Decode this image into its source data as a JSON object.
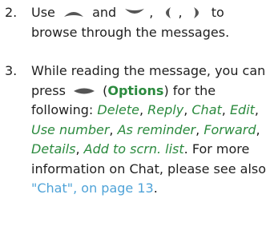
{
  "step1": {
    "number": "2.",
    "text_use": "Use",
    "text_and": "and",
    "text_comma1": ",",
    "text_comma2": ",",
    "text_to": "to",
    "text_rest": "browse through the messages."
  },
  "step2": {
    "number": "3.",
    "text_intro": "While reading the message, you can press",
    "paren_open": "(",
    "options_label": "Options",
    "paren_close": ")",
    "text_following": "for the following:",
    "options": [
      "Delete",
      "Reply",
      "Chat",
      "Edit",
      "Use number",
      "As reminder",
      "Forward",
      "Details",
      "Add to scrn. list"
    ],
    "text_more": "For more information on Chat, please see also",
    "link_text": "\"Chat\", on page 13",
    "end_period": "."
  },
  "icons": {
    "scroll_up": "scroll-up-key-icon",
    "scroll_down": "scroll-down-key-icon",
    "scroll_left": "scroll-left-key-icon",
    "scroll_right": "scroll-right-key-icon",
    "selection_key": "selection-key-icon"
  },
  "colors": {
    "text": "#1f1f1f",
    "italic_green": "#2b8a3e",
    "link": "#4fa3d8",
    "key_grey": "#555555"
  }
}
